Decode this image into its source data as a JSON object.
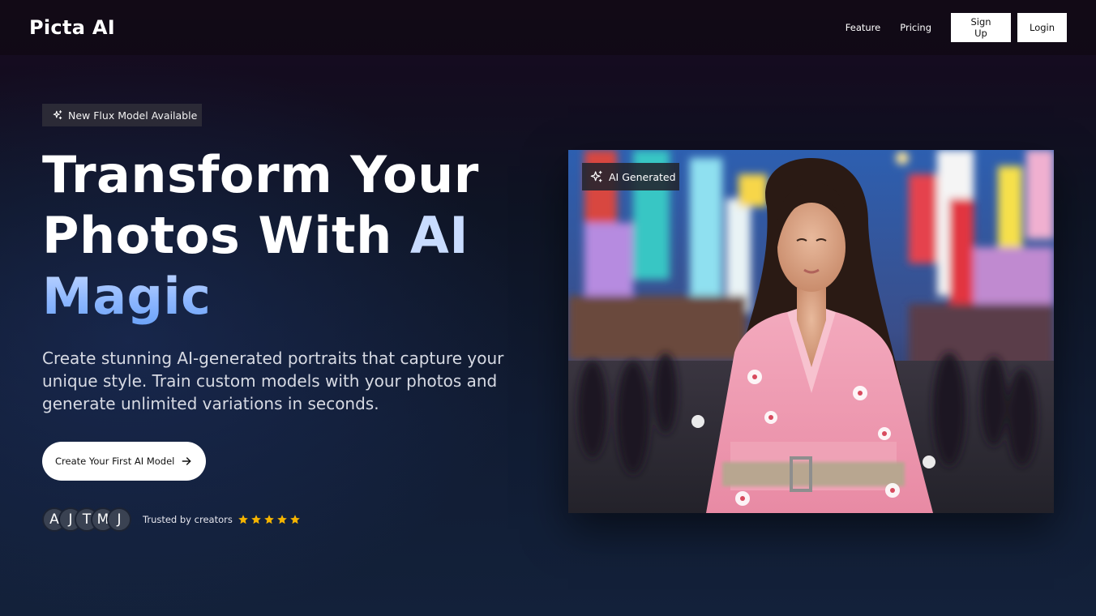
{
  "header": {
    "brand": "Picta AI",
    "nav": {
      "feature": "Feature",
      "pricing": "Pricing"
    },
    "signup_label": "Sign Up",
    "login_label": "Login"
  },
  "hero": {
    "badge": {
      "icon": "sparkles-icon",
      "text": "New Flux Model Available"
    },
    "headline": {
      "line1": "Transform Your",
      "line2_white": "Photos With ",
      "line2_accent": "AI",
      "line3_accent": "Magic"
    },
    "lead": "Create stunning AI-generated portraits that capture your unique style. Train custom models with your photos and generate unlimited variations in seconds.",
    "cta_label": "Create Your First AI Model",
    "cta_icon": "arrow-right-icon",
    "avatars": [
      "A",
      "J",
      "T",
      "M",
      "J"
    ],
    "trusted_text": "Trusted by creators",
    "rating_stars": 5,
    "image_tag": {
      "icon": "sparkles-icon",
      "text": "AI Generated"
    }
  },
  "colors": {
    "accent_text": "#8fb8ff",
    "star": "#f5b400",
    "button_bg": "#ffffff"
  }
}
